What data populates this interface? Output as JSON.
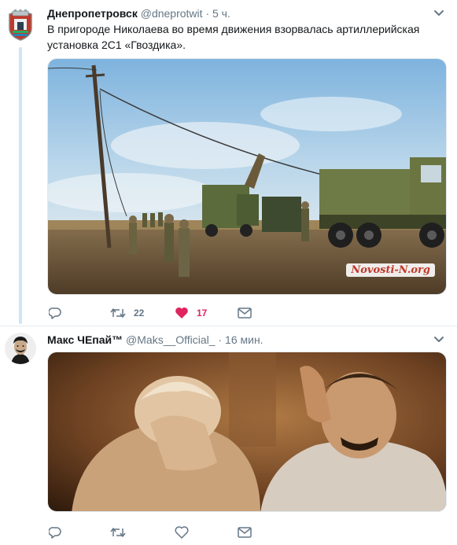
{
  "tweets": [
    {
      "author_name": "Днепропетровск",
      "handle": "@dneprotwit",
      "separator": "·",
      "time": "5 ч.",
      "text": "В пригороде Николаева во время движения взорвалась артиллерийская установка 2С1 «Гвоздика».",
      "media_watermark": "Novosti-N.org",
      "actions": {
        "reply_count": "",
        "retweet_count": "22",
        "like_count": "17",
        "liked": true
      }
    },
    {
      "author_name": "Макс ЧЕпай™",
      "handle": "@Maks__Official_",
      "separator": "·",
      "time": "16 мин.",
      "text": "",
      "actions": {
        "reply_count": "",
        "retweet_count": "",
        "like_count": "",
        "liked": false
      }
    }
  ],
  "colors": {
    "accent": "#1da1f2",
    "like_active": "#e0245e",
    "secondary_text": "#657786",
    "thread_line": "#cfe4f7"
  },
  "icons": [
    "coat-of-arms-icon",
    "caret-down-icon",
    "reply-icon",
    "retweet-icon",
    "heart-icon",
    "direct-message-icon"
  ]
}
